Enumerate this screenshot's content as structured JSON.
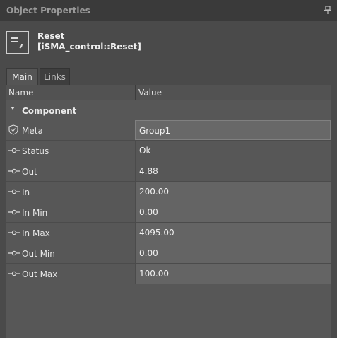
{
  "panel": {
    "title": "Object Properties"
  },
  "object": {
    "name": "Reset",
    "type": "[iSMA_control::Reset]"
  },
  "tabs": [
    {
      "label": "Main"
    },
    {
      "label": "Links"
    }
  ],
  "grid": {
    "columns": {
      "name": "Name",
      "value": "Value"
    },
    "group": "Component",
    "rows": [
      {
        "label": "Meta",
        "value": "Group1"
      },
      {
        "label": "Status",
        "value": "Ok"
      },
      {
        "label": "Out",
        "value": "4.88"
      },
      {
        "label": "In",
        "value": "200.00"
      },
      {
        "label": "In Min",
        "value": "0.00"
      },
      {
        "label": "In Max",
        "value": "4095.00"
      },
      {
        "label": "Out Min",
        "value": "0.00"
      },
      {
        "label": "Out Max",
        "value": "100.00"
      }
    ]
  }
}
